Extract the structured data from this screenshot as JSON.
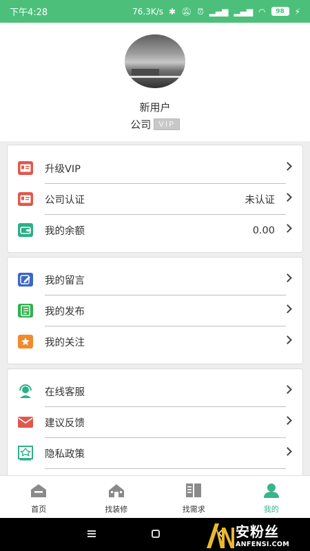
{
  "status_bar": {
    "time": "下午4:28",
    "network_speed": "76.3K/s",
    "battery": "98"
  },
  "profile": {
    "username": "新用户",
    "company": "公司",
    "vip_badge": "VIP"
  },
  "menu_groups": [
    [
      {
        "label": "升级VIP",
        "value": "",
        "icon": "id-card-icon",
        "color": "#e0584d"
      },
      {
        "label": "公司认证",
        "value": "未认证",
        "icon": "id-card-icon",
        "color": "#e0584d"
      },
      {
        "label": "我的余额",
        "value": "0.00",
        "icon": "wallet-icon",
        "color": "#2bb089"
      }
    ],
    [
      {
        "label": "我的留言",
        "value": "",
        "icon": "edit-note-icon",
        "color": "#3a67c9"
      },
      {
        "label": "我的发布",
        "value": "",
        "icon": "list-doc-icon",
        "color": "#2fb24d"
      },
      {
        "label": "我的关注",
        "value": "",
        "icon": "star-icon",
        "color": "#f08a2c"
      }
    ],
    [
      {
        "label": "在线客服",
        "value": "",
        "icon": "headset-icon",
        "color": "#2bb089"
      },
      {
        "label": "建议反馈",
        "value": "",
        "icon": "mail-icon",
        "color": "#e0584d"
      },
      {
        "label": "隐私政策",
        "value": "",
        "icon": "shield-doc-icon",
        "color": "#2bb089"
      }
    ]
  ],
  "tabs": [
    {
      "label": "首页",
      "icon": "home-icon",
      "active": false
    },
    {
      "label": "找装修",
      "icon": "house-icon",
      "active": false
    },
    {
      "label": "找需求",
      "icon": "book-icon",
      "active": false
    },
    {
      "label": "我的",
      "icon": "user-icon",
      "active": true
    }
  ],
  "colors": {
    "accent": "#4cc07a",
    "active_tab": "#38b48b"
  },
  "watermark": {
    "cn": "安粉丝",
    "en": "ANFENSI.COM"
  }
}
